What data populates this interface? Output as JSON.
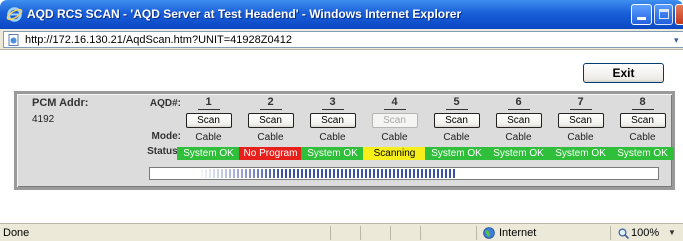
{
  "window": {
    "title": "AQD RCS SCAN - 'AQD Server at Test Headend' - Windows Internet Explorer"
  },
  "address": {
    "url": "http://172.16.130.21/AqdScan.htm?UNIT=41928Z0412"
  },
  "toolbar": {
    "exit_label": "Exit"
  },
  "panel": {
    "pcm_label": "PCM Addr:",
    "pcm_value": "4192",
    "aqd_label": "AQD#:",
    "mode_label": "Mode:",
    "status_label": "Status:",
    "columns": [
      {
        "num": "1",
        "scan": "Scan",
        "mode": "Cable",
        "status": "System OK"
      },
      {
        "num": "2",
        "scan": "Scan",
        "mode": "Cable",
        "status": "No Program"
      },
      {
        "num": "3",
        "scan": "Scan",
        "mode": "Cable",
        "status": "System OK"
      },
      {
        "num": "4",
        "scan": "Scan",
        "mode": "Cable",
        "status": "Scanning"
      },
      {
        "num": "5",
        "scan": "Scan",
        "mode": "Cable",
        "status": "System OK"
      },
      {
        "num": "6",
        "scan": "Scan",
        "mode": "Cable",
        "status": "System OK"
      },
      {
        "num": "7",
        "scan": "Scan",
        "mode": "Cable",
        "status": "System OK"
      },
      {
        "num": "8",
        "scan": "Scan",
        "mode": "Cable",
        "status": "System OK"
      }
    ],
    "column_states": [
      "ok",
      "error",
      "ok",
      "scanning",
      "ok",
      "ok",
      "ok",
      "ok"
    ],
    "scan_disabled": [
      false,
      false,
      false,
      true,
      false,
      false,
      false,
      false
    ],
    "scan_progress": {
      "fraction_start": 0.1,
      "fraction_end": 0.6
    }
  },
  "colors": {
    "ok_bg": "#2fbf3a",
    "ok_text": "#ffffff",
    "error_bg": "#e8201b",
    "error_text": "#ffffff",
    "scanning_bg": "#f7ef1a",
    "scanning_text": "#000000",
    "progress_stripe": "#3a4fa8"
  },
  "statusbar": {
    "status": "Done",
    "zone": "Internet",
    "zoom": "100%"
  }
}
